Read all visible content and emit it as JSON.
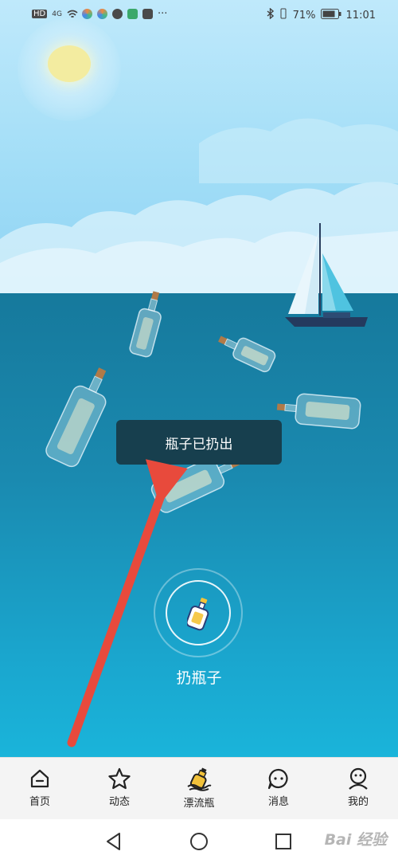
{
  "status_bar": {
    "network": "HD",
    "signal": "4G",
    "battery_percent": "71%",
    "time": "11:01"
  },
  "toast": {
    "text": "瓶子已扔出"
  },
  "throw_button": {
    "label": "扔瓶子"
  },
  "tabs": [
    {
      "label": "首页",
      "icon": "home-icon"
    },
    {
      "label": "动态",
      "icon": "star-icon"
    },
    {
      "label": "漂流瓶",
      "icon": "drift-bottle-icon"
    },
    {
      "label": "消息",
      "icon": "chat-icon"
    },
    {
      "label": "我的",
      "icon": "profile-icon"
    }
  ],
  "nav": {
    "back": "back-icon",
    "home": "home-circle-icon",
    "recent": "recent-apps-icon"
  },
  "watermark": "Bai 经验",
  "colors": {
    "sea": "#1a8ab0",
    "toast_bg": "#173f4e",
    "arrow": "#e84a3c",
    "tabbar_bg": "#f4f4f4"
  }
}
